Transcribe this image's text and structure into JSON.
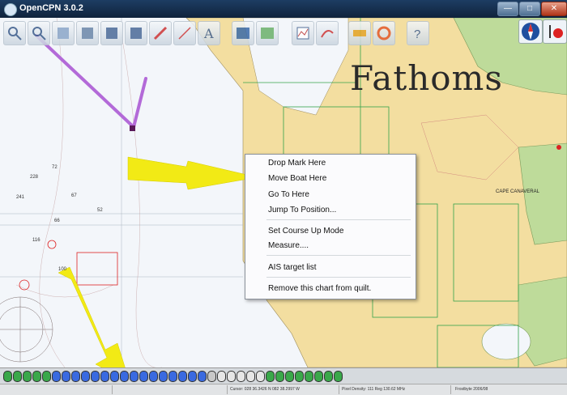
{
  "window": {
    "title": "OpenCPN 3.0.2"
  },
  "watermark": "Fathoms",
  "context_menu": {
    "items": [
      "Drop Mark Here",
      "Move Boat Here",
      "Go To Here",
      "Jump To Position...",
      "Set Course Up Mode",
      "Measure....",
      "AIS target list",
      "Remove this chart from quilt."
    ]
  },
  "toolbar": {
    "icons": [
      "zoom-in-icon",
      "zoom-out-icon",
      "scale-in-icon",
      "scale-out-icon",
      "route-icon",
      "waypoint-icon",
      "follow-icon",
      "settings-icon",
      "text-icon",
      "quilt-icon",
      "tides-icon",
      "route-manager-icon",
      "track-icon",
      "color-scheme-icon",
      "print-icon",
      "help-icon"
    ]
  },
  "chart_labels": {
    "cape_canaveral": "CAPE CANAVERAL",
    "sounding_228": "228",
    "sounding_241": "241",
    "sounding_72": "72",
    "sounding_67": "67",
    "sounding_52": "52",
    "sounding_66": "66",
    "sounding_116": "116",
    "sounding_100": "100"
  },
  "status": {
    "cursor": "Cursor: 028 36.3426 N 082 38.2997 W",
    "pixel_density": "Pixel Density: 111 Reg  130.62 MHz",
    "cog": "Frostbyte  2006/08"
  },
  "colors": {
    "land": "#f3dea0",
    "land_green": "#bedb9a",
    "water": "#f3f6fa",
    "route": "#b36ad8",
    "arrow": "#f2ea15"
  }
}
